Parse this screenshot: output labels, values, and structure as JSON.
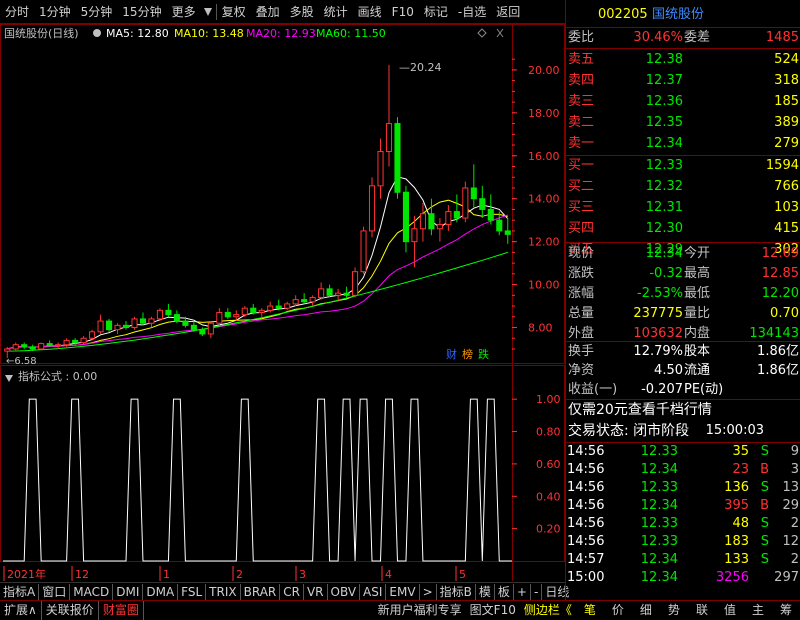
{
  "toolbar": {
    "items": [
      "分时",
      "1分钟",
      "5分钟",
      "15分钟",
      "更多",
      "复权",
      "叠加",
      "多股",
      "统计",
      "画线",
      "F10",
      "标记",
      "-自选",
      "返回"
    ]
  },
  "chart_header": {
    "name": "国统股份(日线)",
    "ma5": "MA5: 12.80",
    "ma10": "MA10: 13.48",
    "ma20": "MA20: 12.93",
    "ma60": "MA60: 11.50"
  },
  "colors": {
    "up": "#ff3232",
    "down": "#00e600",
    "ma5": "#ffffff",
    "ma10": "#ffff00",
    "ma20": "#ff00ff",
    "ma60": "#00ff00",
    "grid": "#800000",
    "axis": "#ff3232"
  },
  "chart_data": [
    {
      "type": "candlestick",
      "title": "国统股份(日线)",
      "y_ticks": [
        8.0,
        10.0,
        12.0,
        14.0,
        16.0,
        18.0,
        20.0
      ],
      "ylim": [
        6.3,
        21.3
      ],
      "high_label": "20.24",
      "low_label": "6.58",
      "ma_series": [
        {
          "name": "MA5",
          "value": 12.8
        },
        {
          "name": "MA10",
          "value": 13.48
        },
        {
          "name": "MA20",
          "value": 12.93
        },
        {
          "name": "MA60",
          "value": 11.5
        }
      ],
      "ohlc": [
        [
          6.9,
          7.1,
          6.58,
          7.0
        ],
        [
          7.0,
          7.3,
          6.9,
          7.2
        ],
        [
          7.2,
          7.3,
          7.0,
          7.1
        ],
        [
          7.1,
          7.2,
          6.9,
          7.0
        ],
        [
          7.0,
          7.3,
          6.95,
          7.25
        ],
        [
          7.25,
          7.4,
          7.1,
          7.15
        ],
        [
          7.15,
          7.3,
          7.0,
          7.2
        ],
        [
          7.2,
          7.5,
          7.1,
          7.4
        ],
        [
          7.4,
          7.5,
          7.2,
          7.3
        ],
        [
          7.3,
          7.6,
          7.2,
          7.5
        ],
        [
          7.5,
          7.9,
          7.4,
          7.8
        ],
        [
          7.8,
          8.6,
          7.7,
          8.3
        ],
        [
          8.3,
          8.4,
          7.8,
          7.9
        ],
        [
          7.9,
          8.2,
          7.7,
          8.1
        ],
        [
          8.1,
          8.3,
          7.9,
          8.0
        ],
        [
          8.0,
          8.5,
          7.9,
          8.4
        ],
        [
          8.4,
          8.7,
          8.1,
          8.2
        ],
        [
          8.2,
          8.5,
          8.0,
          8.4
        ],
        [
          8.4,
          8.9,
          8.3,
          8.8
        ],
        [
          8.8,
          9.1,
          8.5,
          8.6
        ],
        [
          8.6,
          8.8,
          8.2,
          8.3
        ],
        [
          8.3,
          8.5,
          8.0,
          8.1
        ],
        [
          8.1,
          8.3,
          7.8,
          7.9
        ],
        [
          7.9,
          8.0,
          7.6,
          7.7
        ],
        [
          7.7,
          8.3,
          7.5,
          8.2
        ],
        [
          8.2,
          8.9,
          8.1,
          8.7
        ],
        [
          8.7,
          8.9,
          8.4,
          8.5
        ],
        [
          8.5,
          8.8,
          8.3,
          8.6
        ],
        [
          8.6,
          9.0,
          8.5,
          8.9
        ],
        [
          8.9,
          9.1,
          8.6,
          8.7
        ],
        [
          8.7,
          8.9,
          8.5,
          8.8
        ],
        [
          8.8,
          9.2,
          8.7,
          9.0
        ],
        [
          9.0,
          9.3,
          8.8,
          8.9
        ],
        [
          8.9,
          9.2,
          8.8,
          9.1
        ],
        [
          9.1,
          9.5,
          9.0,
          9.3
        ],
        [
          9.3,
          9.6,
          9.1,
          9.2
        ],
        [
          9.2,
          9.5,
          9.0,
          9.4
        ],
        [
          9.4,
          10.1,
          9.3,
          9.8
        ],
        [
          9.8,
          10.0,
          9.4,
          9.5
        ],
        [
          9.5,
          9.8,
          9.2,
          9.6
        ],
        [
          9.6,
          9.9,
          9.4,
          9.5
        ],
        [
          9.5,
          10.8,
          9.4,
          10.6
        ],
        [
          10.6,
          12.7,
          10.5,
          12.5
        ],
        [
          12.5,
          15.0,
          12.2,
          14.6
        ],
        [
          14.6,
          16.8,
          14.0,
          16.2
        ],
        [
          16.2,
          20.24,
          15.5,
          17.5
        ],
        [
          17.5,
          17.8,
          14.0,
          14.3
        ],
        [
          14.3,
          14.6,
          11.5,
          12.0
        ],
        [
          12.0,
          13.2,
          10.8,
          12.6
        ],
        [
          12.6,
          13.8,
          12.0,
          13.3
        ],
        [
          13.3,
          14.0,
          12.3,
          12.6
        ],
        [
          12.6,
          13.1,
          12.0,
          12.8
        ],
        [
          12.8,
          13.7,
          12.5,
          13.4
        ],
        [
          13.4,
          14.2,
          12.9,
          13.1
        ],
        [
          13.1,
          14.8,
          12.9,
          14.5
        ],
        [
          14.5,
          15.6,
          13.6,
          14.0
        ],
        [
          14.0,
          14.6,
          13.1,
          13.5
        ],
        [
          13.5,
          14.2,
          12.8,
          13.0
        ],
        [
          13.0,
          13.4,
          12.3,
          12.5
        ],
        [
          12.5,
          13.1,
          11.9,
          12.34
        ]
      ]
    },
    {
      "type": "line",
      "title": "指标公式 : 0.00",
      "y_ticks": [
        0.2,
        0.4,
        0.6,
        0.8,
        1.0
      ],
      "ylim": [
        0,
        1.1
      ],
      "spikes": [
        3,
        8,
        15,
        20,
        28,
        37,
        40,
        42,
        45,
        48,
        55,
        57
      ],
      "x_labels": [
        "2021年",
        "12",
        "1",
        "2",
        "3",
        "4",
        "5"
      ]
    }
  ],
  "stock": {
    "code": "002205",
    "name": "国统股份"
  },
  "weibi": {
    "label1": "委比",
    "v1": "30.46%",
    "label2": "委差",
    "v2": "1485"
  },
  "sell": [
    {
      "l": "卖五",
      "p": "12.38",
      "v": "524"
    },
    {
      "l": "卖四",
      "p": "12.37",
      "v": "318"
    },
    {
      "l": "卖三",
      "p": "12.36",
      "v": "185"
    },
    {
      "l": "卖二",
      "p": "12.35",
      "v": "389"
    },
    {
      "l": "卖一",
      "p": "12.34",
      "v": "279"
    }
  ],
  "buy": [
    {
      "l": "买一",
      "p": "12.33",
      "v": "1594"
    },
    {
      "l": "买二",
      "p": "12.32",
      "v": "766"
    },
    {
      "l": "买三",
      "p": "12.31",
      "v": "103"
    },
    {
      "l": "买四",
      "p": "12.30",
      "v": "415"
    },
    {
      "l": "买五",
      "p": "12.29",
      "v": "302"
    }
  ],
  "quote": [
    {
      "l1": "现价",
      "v1": "12.34",
      "c1": "#00e600",
      "l2": "今开",
      "v2": "12.69",
      "c2": "#ff3232"
    },
    {
      "l1": "涨跌",
      "v1": "-0.32",
      "c1": "#00e600",
      "l2": "最高",
      "v2": "12.85",
      "c2": "#ff3232"
    },
    {
      "l1": "涨幅",
      "v1": "-2.53%",
      "c1": "#00e600",
      "l2": "最低",
      "v2": "12.20",
      "c2": "#00e600"
    },
    {
      "l1": "总量",
      "v1": "237775",
      "c1": "#ffff00",
      "l2": "量比",
      "v2": "0.70",
      "c2": "#ffff00"
    },
    {
      "l1": "外盘",
      "v1": "103632",
      "c1": "#ff3232",
      "l2": "内盘",
      "v2": "134143",
      "c2": "#00e600"
    }
  ],
  "info": [
    {
      "l1": "换手",
      "v1": "12.79%",
      "l2": "股本",
      "v2": "1.86亿"
    },
    {
      "l1": "净资",
      "v1": "4.50",
      "l2": "流通",
      "v2": "1.86亿"
    },
    {
      "l1": "收益(一)",
      "v1": "-0.207",
      "l2": "PE(动)",
      "v2": ""
    }
  ],
  "promo": "仅需20元查看千档行情",
  "status": {
    "label": "交易状态: 闭市阶段",
    "time": "15:00:03"
  },
  "ticks": [
    {
      "t": "14:56",
      "p": "12.33",
      "v": "35",
      "s": "S",
      "n": "9"
    },
    {
      "t": "14:56",
      "p": "12.34",
      "v": "23",
      "s": "B",
      "n": "3"
    },
    {
      "t": "14:56",
      "p": "12.33",
      "v": "136",
      "s": "S",
      "n": "13"
    },
    {
      "t": "14:56",
      "p": "12.34",
      "v": "395",
      "s": "B",
      "n": "29"
    },
    {
      "t": "14:56",
      "p": "12.33",
      "v": "48",
      "s": "S",
      "n": "2"
    },
    {
      "t": "14:56",
      "p": "12.33",
      "v": "183",
      "s": "S",
      "n": "12"
    },
    {
      "t": "14:57",
      "p": "12.34",
      "v": "133",
      "s": "S",
      "n": "2"
    },
    {
      "t": "15:00",
      "p": "12.34",
      "v": "3256",
      "s": "",
      "n": "297"
    }
  ],
  "indicator_tabs": [
    "指标A",
    "窗口",
    "MACD",
    "DMI",
    "DMA",
    "FSL",
    "TRIX",
    "BRAR",
    "CR",
    "VR",
    "OBV",
    "ASI",
    "EMV",
    ">",
    "指标B",
    "模",
    "板",
    "+",
    "-",
    "日线"
  ],
  "bottom_left": [
    "扩展∧",
    "关联报价",
    "财富圈"
  ],
  "bottom_mid": [
    "新用户福利专享",
    "图文F10",
    "侧边栏《"
  ],
  "bottom_right": [
    "笔",
    "价",
    "细",
    "势",
    "联",
    "值",
    "主",
    "筹"
  ],
  "badges": [
    "财",
    "榜",
    "跌"
  ]
}
